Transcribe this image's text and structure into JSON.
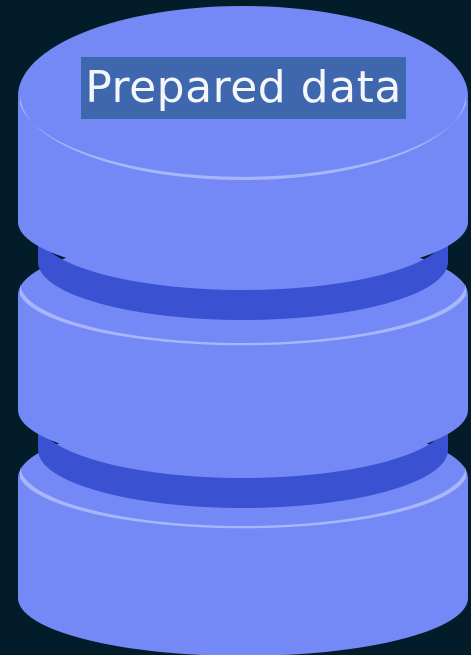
{
  "diagram": {
    "label": "Prepared data"
  },
  "colors": {
    "background": "#021c2a",
    "disk_body": "#7589f6",
    "disk_rim": "#a8b7fb",
    "disk_gap": "#3a52d2",
    "label_bg": "#3e67ae",
    "label_text": "#f4f6fb"
  },
  "icons": [
    "database-cylinder-icon"
  ]
}
